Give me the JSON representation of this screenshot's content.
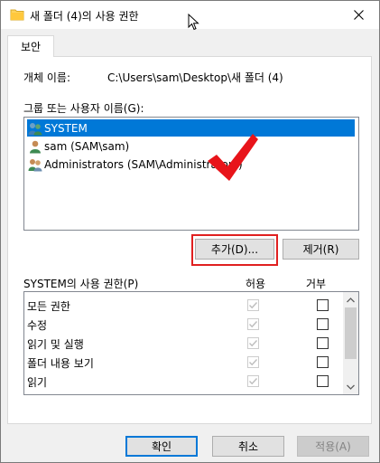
{
  "window": {
    "title": "새 폴더 (4)의 사용 권한"
  },
  "tabs": [
    {
      "label": "보안"
    }
  ],
  "object": {
    "label": "개체 이름:",
    "value": "C:\\Users\\sam\\Desktop\\새 폴더 (4)"
  },
  "groups": {
    "label": "그룹 또는 사용자 이름(G):",
    "items": [
      {
        "label": "SYSTEM",
        "icon": "users-group-icon",
        "selected": true
      },
      {
        "label": "sam (SAM\\sam)",
        "icon": "user-icon",
        "selected": false
      },
      {
        "label": "Administrators (SAM\\Administrators)",
        "icon": "users-group-icon",
        "selected": false
      }
    ]
  },
  "actions": {
    "add_label": "추가(D)...",
    "remove_label": "제거(R)"
  },
  "permissions": {
    "label": "SYSTEM의 사용 권한(P)",
    "allow_header": "허용",
    "deny_header": "거부",
    "rows": [
      {
        "name": "모든 권한",
        "allow": true,
        "deny": false
      },
      {
        "name": "수정",
        "allow": true,
        "deny": false
      },
      {
        "name": "읽기 및 실행",
        "allow": true,
        "deny": false
      },
      {
        "name": "폴더 내용 보기",
        "allow": true,
        "deny": false
      },
      {
        "name": "읽기",
        "allow": true,
        "deny": false
      }
    ]
  },
  "footer": {
    "ok_label": "확인",
    "cancel_label": "취소",
    "apply_label": "적용(A)"
  },
  "colors": {
    "selection": "#0078d7",
    "highlight": "#e02020"
  }
}
